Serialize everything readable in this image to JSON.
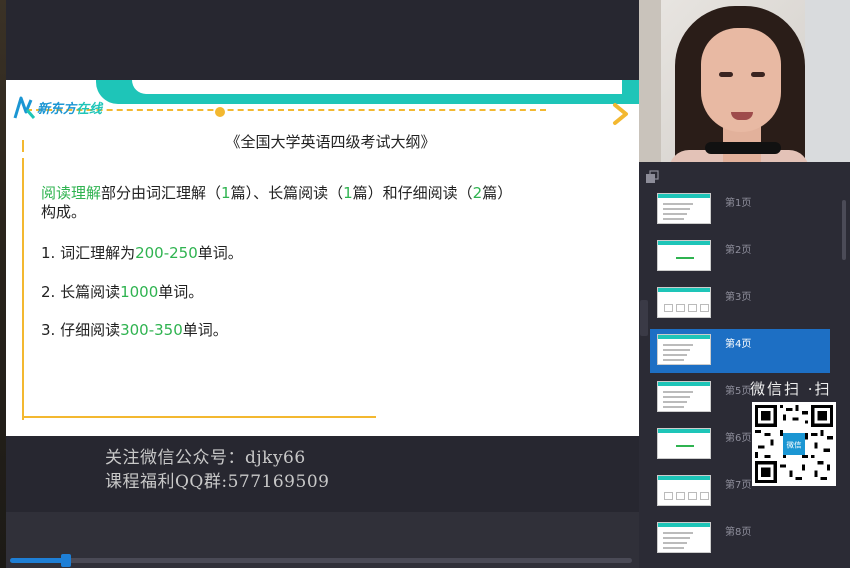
{
  "slide": {
    "logo_text_a": "新东方",
    "logo_text_b": "在线",
    "title": "《全国大学英语四级考试大纲》",
    "para_highlight": "阅读理解",
    "para_t1": "部分由词汇理解（",
    "para_n1": "1",
    "para_t2": "篇）、长篇阅读（",
    "para_n2": "1",
    "para_t3": "篇）和仔细阅读（",
    "para_n3": "2",
    "para_t4": "篇）",
    "para_line2": "构成。",
    "items": [
      {
        "prefix": "1. 词汇理解为",
        "value": "200-250",
        "suffix": "单词。"
      },
      {
        "prefix": "2. 长篇阅读",
        "value": "1000",
        "suffix": "单词。"
      },
      {
        "prefix": "3. 仔细阅读",
        "value": "300-350",
        "suffix": "单词。"
      }
    ]
  },
  "watermark": {
    "line1": "关注微信公众号：djky66",
    "line2": "课程福利QQ群:577169509"
  },
  "player": {
    "progress": 0.09
  },
  "thumbnails": [
    {
      "label": "第1页",
      "active": false
    },
    {
      "label": "第2页",
      "active": false
    },
    {
      "label": "第3页",
      "active": false
    },
    {
      "label": "第4页",
      "active": true
    },
    {
      "label": "第5页",
      "active": false
    },
    {
      "label": "第6页",
      "active": false
    },
    {
      "label": "第7页",
      "active": false
    },
    {
      "label": "第8页",
      "active": false
    }
  ],
  "qr": {
    "caption": "微信扫 ·扫",
    "center_text": "微信"
  },
  "colors": {
    "accent_teal": "#1ec5b8",
    "accent_yellow": "#f3b830",
    "highlight_green": "#2fb350",
    "active_blue": "#1d6fc4"
  }
}
